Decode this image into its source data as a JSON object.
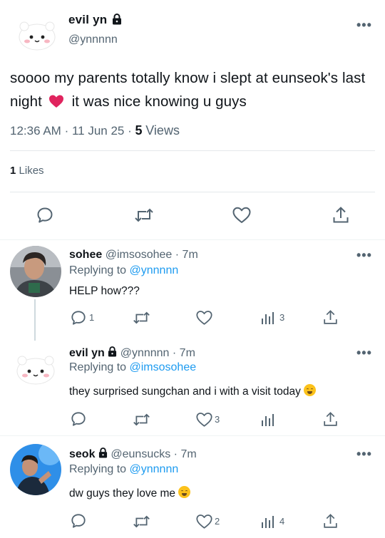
{
  "main_tweet": {
    "display_name": "evil yn",
    "handle": "@ynnnnn",
    "text_part1": "soooo my parents totally know i slept at eunseok's last night",
    "text_part2": "it was nice knowing u guys",
    "time": "12:36 AM",
    "date": "11 Jun 25",
    "views_count": "5",
    "views_label": "Views",
    "likes_count": "1",
    "likes_label": "Likes",
    "more_label": "•••"
  },
  "replies": [
    {
      "display_name": "sohee",
      "handle": "@imsosohee",
      "time": "· 7m",
      "replying_prefix": "Replying to",
      "replying_to": "@ynnnnn",
      "text": "HELP how???",
      "reply_count": "1",
      "like_count": "",
      "views_count": "3"
    },
    {
      "display_name": "evil yn",
      "handle": "@ynnnnn",
      "time": "· 7m",
      "replying_prefix": "Replying to",
      "replying_to": "@imsosohee",
      "text": "they surprised sungchan and i with a visit today",
      "reply_count": "",
      "like_count": "3",
      "views_count": ""
    },
    {
      "display_name": "seok",
      "handle": "@eunsucks",
      "time": "· 7m",
      "replying_prefix": "Replying to",
      "replying_to": "@ynnnnn",
      "text": "dw guys they love me",
      "reply_count": "",
      "like_count": "2",
      "views_count": "4"
    }
  ],
  "icons": {
    "reply": "speech-bubble-icon",
    "retweet": "retweet-icon",
    "like": "heart-icon",
    "views": "bar-chart-icon",
    "share": "share-icon",
    "lock": "lock-icon",
    "emoji": "smiling-face-emoji"
  },
  "colors": {
    "accent": "#1d9bf0",
    "text": "#0f1419",
    "muted": "#536471",
    "heart_emoji": "#e0245e"
  }
}
